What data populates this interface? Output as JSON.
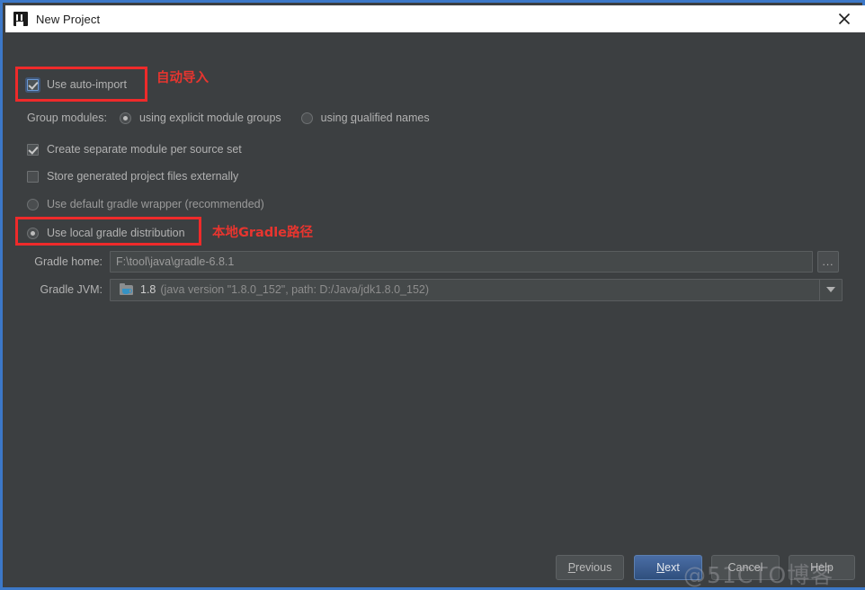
{
  "window": {
    "title": "New Project",
    "icon": "intellij-idea-logo",
    "close_label": "×"
  },
  "options": {
    "use_auto_import": {
      "label": "Use auto-import",
      "checked": true,
      "focused": true
    },
    "group_modules": {
      "label": "Group modules:",
      "choices": [
        {
          "label": "using explicit module groups",
          "selected": true,
          "mnemonic": ""
        },
        {
          "label": "using qualified names",
          "selected": false,
          "mnemonic": "q"
        }
      ]
    },
    "create_separate_module": {
      "label": "Create separate module per source set",
      "checked": true
    },
    "store_generated_external": {
      "label": "Store generated project files externally",
      "checked": false
    },
    "gradle_wrapper": {
      "label": "Use default gradle wrapper (recommended)",
      "selected": false
    },
    "local_gradle": {
      "label": "Use local gradle distribution",
      "selected": true
    }
  },
  "fields": {
    "gradle_home": {
      "label": "Gradle home:",
      "value": "F:\\tool\\java\\gradle-6.8.1",
      "placeholder": "F:\\tool\\java\\gradle-6.8.1",
      "browse_label": "..."
    },
    "gradle_jvm": {
      "label": "Gradle JVM:",
      "version": "1.8",
      "detail": "(java version \"1.8.0_152\", path: D:/Java/jdk1.8.0_152)",
      "icon": "jdk-folder-icon",
      "arrow_icon": "chevron-down-icon"
    }
  },
  "annotations": [
    {
      "text": "自动导入",
      "color": "#e8352f"
    },
    {
      "text": "本地Gradle路径",
      "color": "#e8352f"
    }
  ],
  "footer": {
    "buttons": [
      {
        "label": "Previous",
        "mnemonic": "P",
        "primary": false
      },
      {
        "label": "Next",
        "mnemonic": "N",
        "primary": true
      },
      {
        "label": "Cancel",
        "mnemonic": "",
        "primary": false
      },
      {
        "label": "Help",
        "mnemonic": "",
        "primary": false
      }
    ]
  },
  "watermark": {
    "text": "@51CTO博客"
  }
}
